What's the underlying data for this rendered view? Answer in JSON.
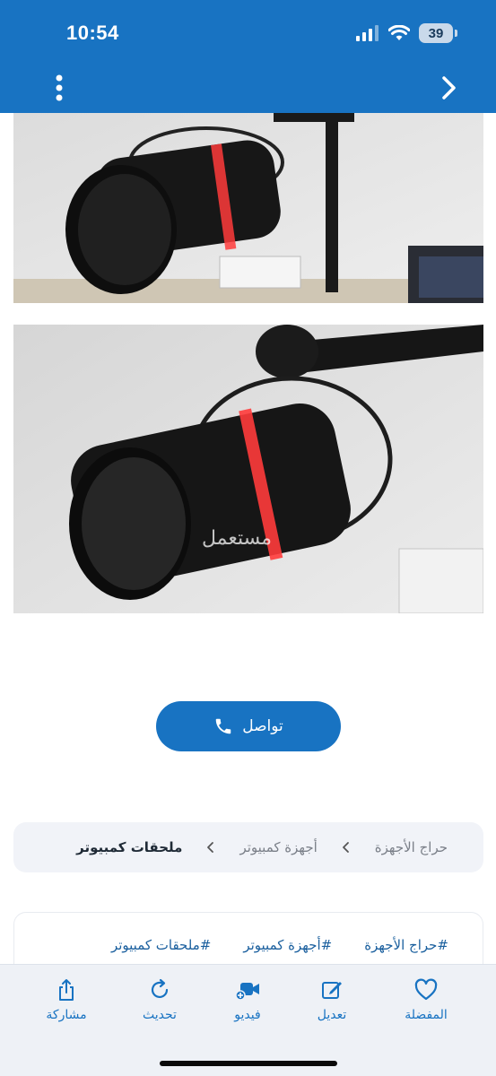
{
  "status_bar": {
    "time": "10:54",
    "battery": "39"
  },
  "header": {
    "menu_icon": "more-vertical-icon",
    "forward_icon": "chevron-right-icon"
  },
  "contact_button": {
    "label": "تواصل",
    "icon": "phone-icon"
  },
  "breadcrumb": {
    "items": [
      "حراج الأجهزة",
      "أجهزة كمبيوتر",
      "ملحقات كمبيوتر"
    ]
  },
  "tags": [
    "#حراج الأجهزة",
    "#أجهزة كمبيوتر",
    "#ملحقات كمبيوتر"
  ],
  "bottom_bar": {
    "favorite": "المفضلة",
    "edit": "تعديل",
    "video": "فيديو",
    "refresh": "تحديث",
    "share": "مشاركة"
  },
  "colors": {
    "brand": "#1873c2",
    "accent_red": "#ff3b3b"
  }
}
